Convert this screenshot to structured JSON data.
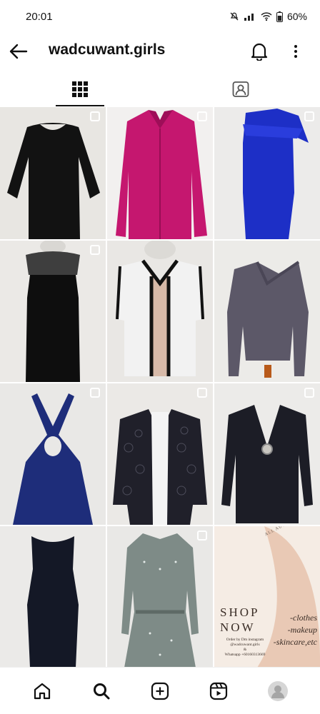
{
  "status_bar": {
    "time": "20:01",
    "battery": "60%",
    "icons": [
      "mute-icon",
      "signal-icon",
      "wifi-icon",
      "battery-icon"
    ]
  },
  "header": {
    "username": "wadcuwant.girls",
    "icons": [
      "back-arrow-icon",
      "bell-icon",
      "more-vertical-icon"
    ]
  },
  "tabs": [
    {
      "name": "posts-grid",
      "icon": "grid-icon",
      "active": true
    },
    {
      "name": "tagged",
      "icon": "tagged-person-icon",
      "active": false
    }
  ],
  "posts": [
    {
      "item": "black-top",
      "colors": [
        "#121212"
      ],
      "multi": true
    },
    {
      "item": "magenta-blouse",
      "colors": [
        "#c5176f"
      ],
      "multi": true
    },
    {
      "item": "blue-dress",
      "colors": [
        "#1d2fc6"
      ],
      "multi": true
    },
    {
      "item": "black-strapless-dress",
      "colors": [
        "#0e0e0e"
      ],
      "multi": true
    },
    {
      "item": "colorblock-cardigan",
      "colors": [
        "#f2f2f2",
        "#d6b9a8",
        "#111111"
      ],
      "multi": false
    },
    {
      "item": "grey-purple-top",
      "colors": [
        "#5c5868"
      ],
      "multi": false
    },
    {
      "item": "navy-halter-dress",
      "colors": [
        "#1e2d7a"
      ],
      "multi": true
    },
    {
      "item": "lace-cardigan",
      "colors": [
        "#20202a"
      ],
      "multi": true
    },
    {
      "item": "black-ring-top",
      "colors": [
        "#1c1d26"
      ],
      "multi": true
    },
    {
      "item": "navy-sleeveless-dress",
      "colors": [
        "#141826"
      ],
      "multi": false
    },
    {
      "item": "grey-patterned-dress",
      "colors": [
        "#7e8b87"
      ],
      "multi": true
    },
    {
      "item": "shop-now-ad",
      "colors": [
        "#efe2d6"
      ],
      "multi": false
    }
  ],
  "ad": {
    "headline": "SHOP NOW",
    "subtext": "Order by Dm instagram\n@wadcuwant.girls\n&\nWhatsapp +60160313669",
    "list": [
      "-clothes",
      "-makeup",
      "-skincare,etc"
    ],
    "arc_text": "ALL AUTHENTIC ITEMS"
  },
  "bottom_nav": [
    {
      "name": "home",
      "icon": "home-icon"
    },
    {
      "name": "search",
      "icon": "search-icon"
    },
    {
      "name": "create",
      "icon": "plus-square-icon"
    },
    {
      "name": "reels",
      "icon": "reels-icon"
    },
    {
      "name": "profile",
      "icon": "profile-avatar-icon"
    }
  ]
}
